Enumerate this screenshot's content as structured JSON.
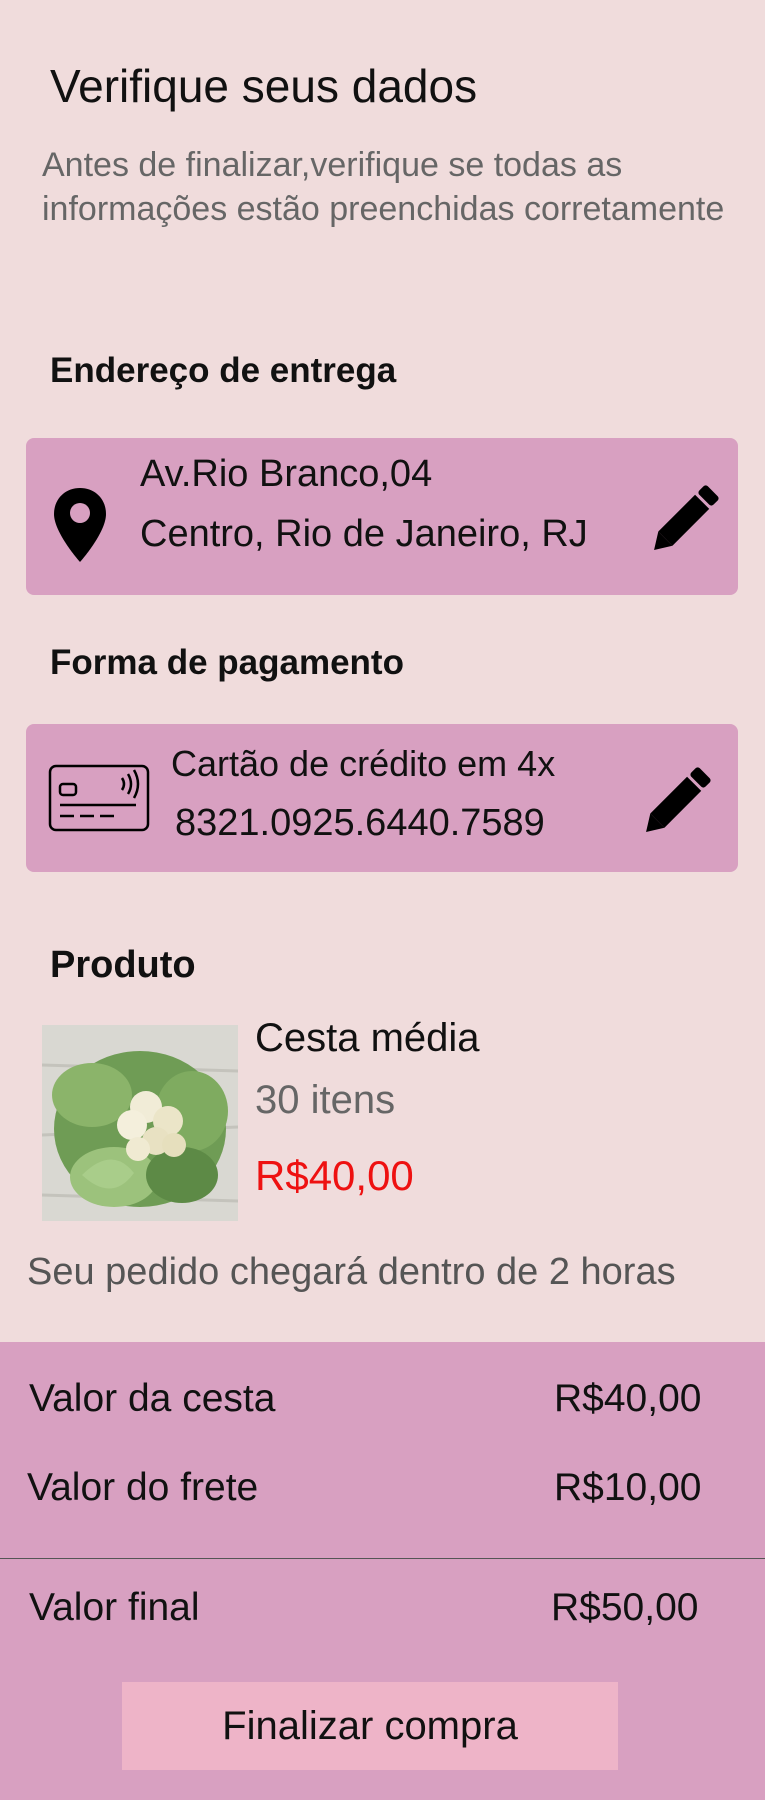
{
  "header": {
    "title": "Verifique seus dados",
    "subtitle": "Antes de finalizar,verifique se todas as informações estão preenchidas corretamente"
  },
  "address": {
    "section_title": "Endereço de entrega",
    "line1": "Av.Rio Branco,04",
    "line2": "Centro, Rio de Janeiro, RJ",
    "icon": "location-pin-icon",
    "edit_icon": "pencil-icon"
  },
  "payment": {
    "section_title": "Forma de pagamento",
    "method": "Cartão de crédito em 4x",
    "card_number": "8321.0925.6440.7589",
    "icon": "credit-card-icon",
    "edit_icon": "pencil-icon"
  },
  "product": {
    "section_title": "Produto",
    "name": "Cesta média",
    "items": "30 itens",
    "price": "R$40,00",
    "image": "cauliflower-image"
  },
  "delivery_note": "Seu pedido chegará dentro de 2 horas",
  "summary": {
    "basket_label": "Valor da cesta",
    "basket_value": "R$40,00",
    "shipping_label": "Valor do frete",
    "shipping_value": "R$10,00",
    "final_label": "Valor final",
    "final_value": "R$50,00"
  },
  "actions": {
    "finish_label": "Finalizar compra"
  },
  "colors": {
    "background": "#f0dcdc",
    "card": "#d8a0c1",
    "button": "#eeb4c8",
    "price": "#ee1111",
    "muted_text": "#666666"
  }
}
